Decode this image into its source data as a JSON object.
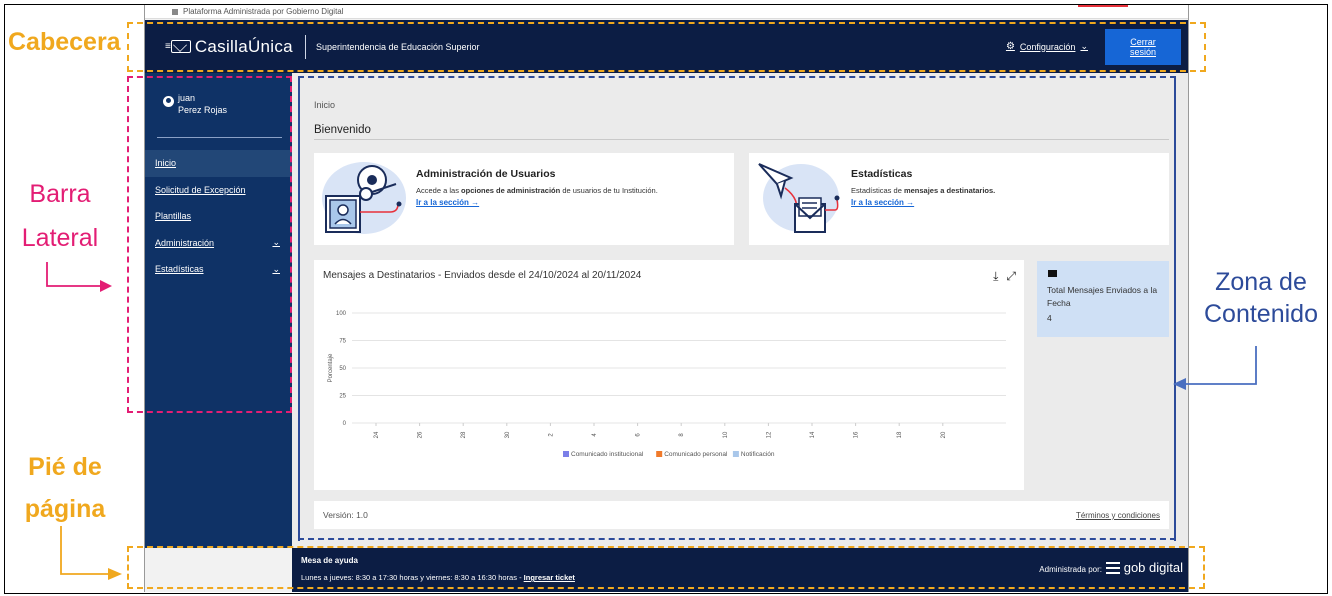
{
  "gov_strip": {
    "text": "Plataforma Administrada por Gobierno Digital"
  },
  "header": {
    "logo_text": "CasillaÚnica",
    "org_name": "Superintendencia de Educación Superior",
    "config_label": "Configuración",
    "logout_label": "Cerrar sesión"
  },
  "sidebar": {
    "user_first": "juan",
    "user_last": "Perez Rojas",
    "items": [
      {
        "label": "Inicio",
        "active": true,
        "expandable": false
      },
      {
        "label": "Solicitud de Excepción",
        "active": false,
        "expandable": false
      },
      {
        "label": "Plantillas",
        "active": false,
        "expandable": false
      },
      {
        "label": "Administración",
        "active": false,
        "expandable": true
      },
      {
        "label": "Estadísticas",
        "active": false,
        "expandable": true
      }
    ]
  },
  "main": {
    "breadcrumb": "Inicio",
    "welcome": "Bienvenido",
    "cards": [
      {
        "title": "Administración de Usuarios",
        "desc_pre": "Accede a las ",
        "desc_bold": "opciones de administración",
        "desc_post": " de usuarios de tu Institución.",
        "link": "Ir a la sección →"
      },
      {
        "title": "Estadísticas",
        "desc_pre": "Estadísticas de ",
        "desc_bold": "mensajes a destinatarios.",
        "desc_post": "",
        "link": "Ir a la sección →"
      }
    ],
    "stat": {
      "label": "Total Mensajes Enviados a la Fecha",
      "value": "4"
    },
    "version": "Versión: 1.0",
    "terms": "Términos y condiciones"
  },
  "chart_data": {
    "type": "bar",
    "title": "Mensajes a Destinatarios - Enviados desde el 24/10/2024 al 20/11/2024",
    "xlabel": "",
    "ylabel": "Porcentaje",
    "ylim": [
      0,
      100
    ],
    "yticks": [
      "100",
      "75",
      "50",
      "25",
      "0"
    ],
    "categories": [
      "24",
      "26",
      "28",
      "30",
      "2",
      "4",
      "6",
      "8",
      "10",
      "12",
      "14",
      "16",
      "18",
      "20"
    ],
    "series": [
      {
        "name": "Comunicado institucional",
        "color": "#7b7fe8",
        "values": [
          0,
          0,
          0,
          0,
          0,
          0,
          0,
          0,
          0,
          0,
          0,
          0,
          0,
          0
        ]
      },
      {
        "name": "Comunicado personal",
        "color": "#f07a2a",
        "values": [
          0,
          0,
          0,
          0,
          0,
          0,
          0,
          0,
          0,
          0,
          0,
          0,
          0,
          0
        ]
      },
      {
        "name": "Notificación",
        "color": "#a9c7ea",
        "values": [
          0,
          0,
          0,
          0,
          0,
          0,
          0,
          0,
          0,
          0,
          0,
          0,
          0,
          0
        ]
      }
    ],
    "grid": true,
    "legend": "bottom"
  },
  "footer": {
    "help_title": "Mesa de ayuda",
    "hours": "Lunes a jueves: 8:30 a 17:30 horas y viernes: 8:30 a 16:30 horas - ",
    "ticket": "Ingresar ticket",
    "admin_label": "Administrada por:",
    "gob": "gob digital"
  },
  "annotations": {
    "header": "Cabecera",
    "sidebar_1": "Barra",
    "sidebar_2": "Lateral",
    "content_1": "Zona de",
    "content_2": "Contenido",
    "footer_1": "Pié de",
    "footer_2": "página",
    "colors": {
      "header": "#f0a81e",
      "sidebar": "#e31d74",
      "content": "#2d4b9a",
      "footer": "#f0a81e"
    }
  }
}
